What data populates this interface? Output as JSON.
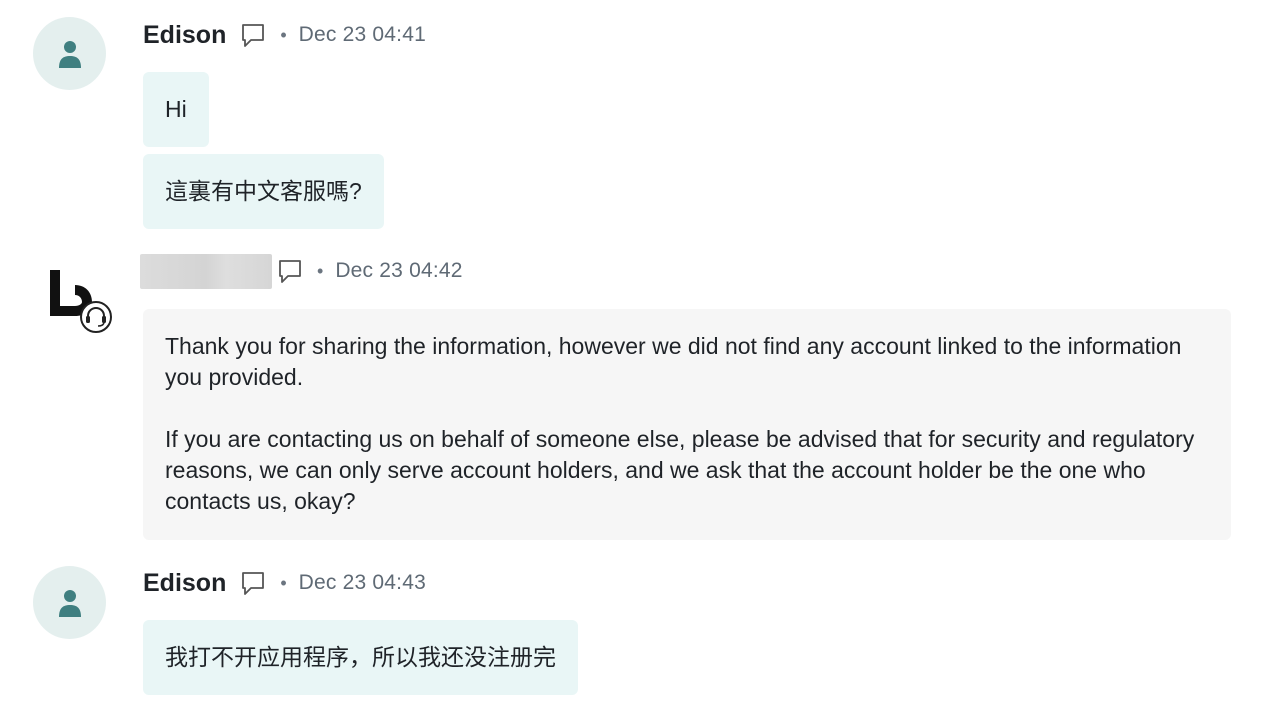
{
  "messages": [
    {
      "sender": "Edison",
      "time": "Dec 23 04:41",
      "bubbles": [
        "Hi",
        "這裏有中文客服嗎?"
      ]
    },
    {
      "sender": "",
      "time": "Dec 23 04:42",
      "paragraphs": [
        "Thank you for sharing the information, however we did not find any account linked to the information you provided.",
        "If you are contacting us on behalf of someone else, please be advised that for security and regulatory reasons, we can only serve account holders, and we ask that the account holder be the one who contacts us, okay?"
      ]
    },
    {
      "sender": "Edison",
      "time": "Dec 23 04:43",
      "bubbles": [
        "我打不开应用程序，所以我还没注册完"
      ]
    }
  ],
  "colors": {
    "user_bubble": "#e9f6f6",
    "agent_bubble": "#f6f6f6",
    "avatar_bg": "#e4efee",
    "avatar_icon": "#3f7f80"
  },
  "icons": {
    "user_avatar": "person-icon",
    "comment": "comment-icon",
    "agent_logo": "brand-logo-with-headset-icon"
  }
}
